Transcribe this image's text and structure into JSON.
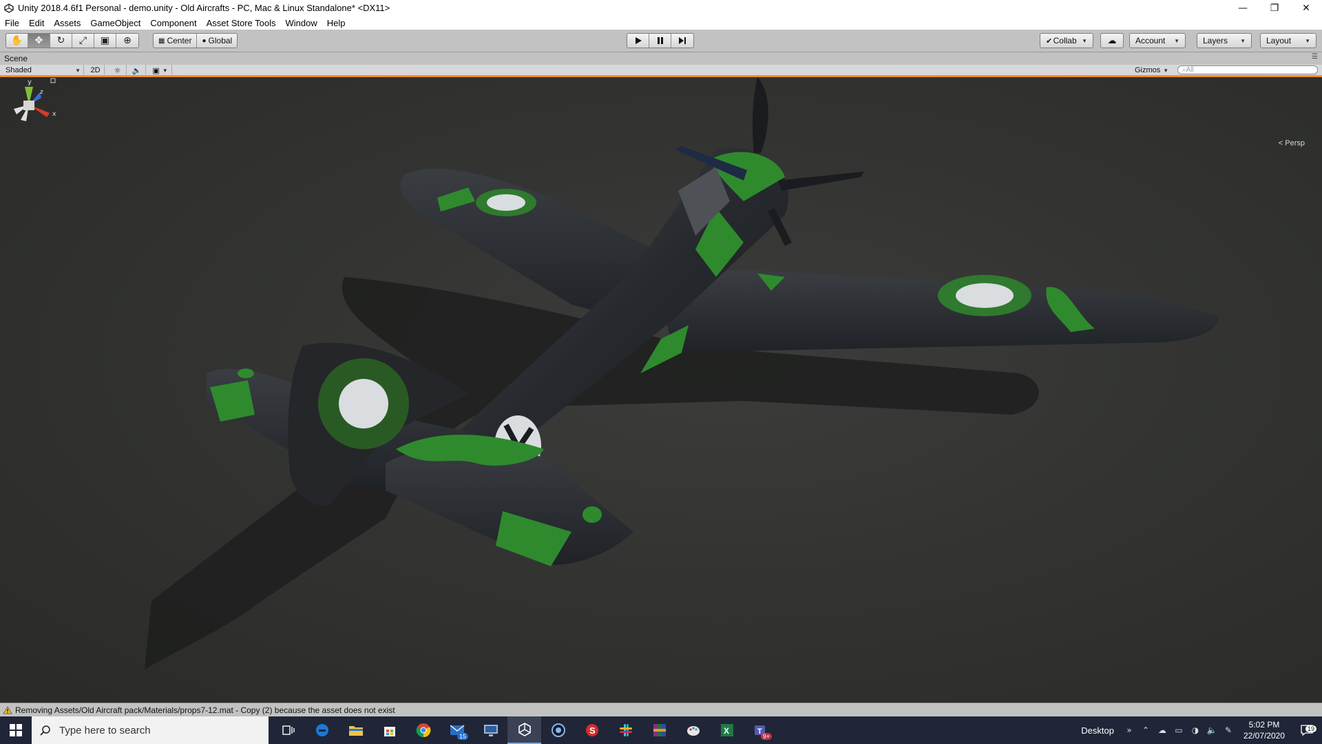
{
  "window": {
    "title": "Unity 2018.4.6f1 Personal - demo.unity - Old Aircrafts - PC, Mac & Linux Standalone* <DX11>",
    "minimize": "—",
    "maximize": "❐",
    "close": "✕"
  },
  "menu": [
    "File",
    "Edit",
    "Assets",
    "GameObject",
    "Component",
    "Asset Store Tools",
    "Window",
    "Help"
  ],
  "toolbar": {
    "tools": [
      {
        "name": "hand-tool",
        "glyph": "✋"
      },
      {
        "name": "move-tool",
        "glyph": "✥"
      },
      {
        "name": "rotate-tool",
        "glyph": "↻"
      },
      {
        "name": "scale-tool",
        "glyph": "⤢"
      },
      {
        "name": "rect-tool",
        "glyph": "▣"
      },
      {
        "name": "transform-tool",
        "glyph": "⊕"
      }
    ],
    "active_tool": "move-tool",
    "pivot_label": "Center",
    "rotation_label": "Global",
    "collab_label": "Collab",
    "account_label": "Account",
    "layers_label": "Layers",
    "layout_label": "Layout"
  },
  "scene": {
    "tab_label": "Scene",
    "shading_mode": "Shaded",
    "mode_2d": "2D",
    "gizmos_label": "Gizmos",
    "search_placeholder": "⌕All",
    "projection_label": "< Persp",
    "axis_labels": {
      "y": "y",
      "z": "z",
      "x": "x"
    }
  },
  "console": {
    "message": "Removing Assets/Old Aircraft pack/Materials/props7-12.mat - Copy (2) because the asset does not exist"
  },
  "taskbar": {
    "search_placeholder": "Type here to search",
    "desktop_label": "Desktop",
    "time": "5:02 PM",
    "date": "22/07/2020",
    "notification_count": "19",
    "mail_badge": "15",
    "teams_badge": "9+"
  },
  "colors": {
    "accent_orange": "#f08a24",
    "camo_green": "#2f8a2e",
    "aircraft_dark": "#23262b",
    "roundel_white": "#d9dde0"
  }
}
